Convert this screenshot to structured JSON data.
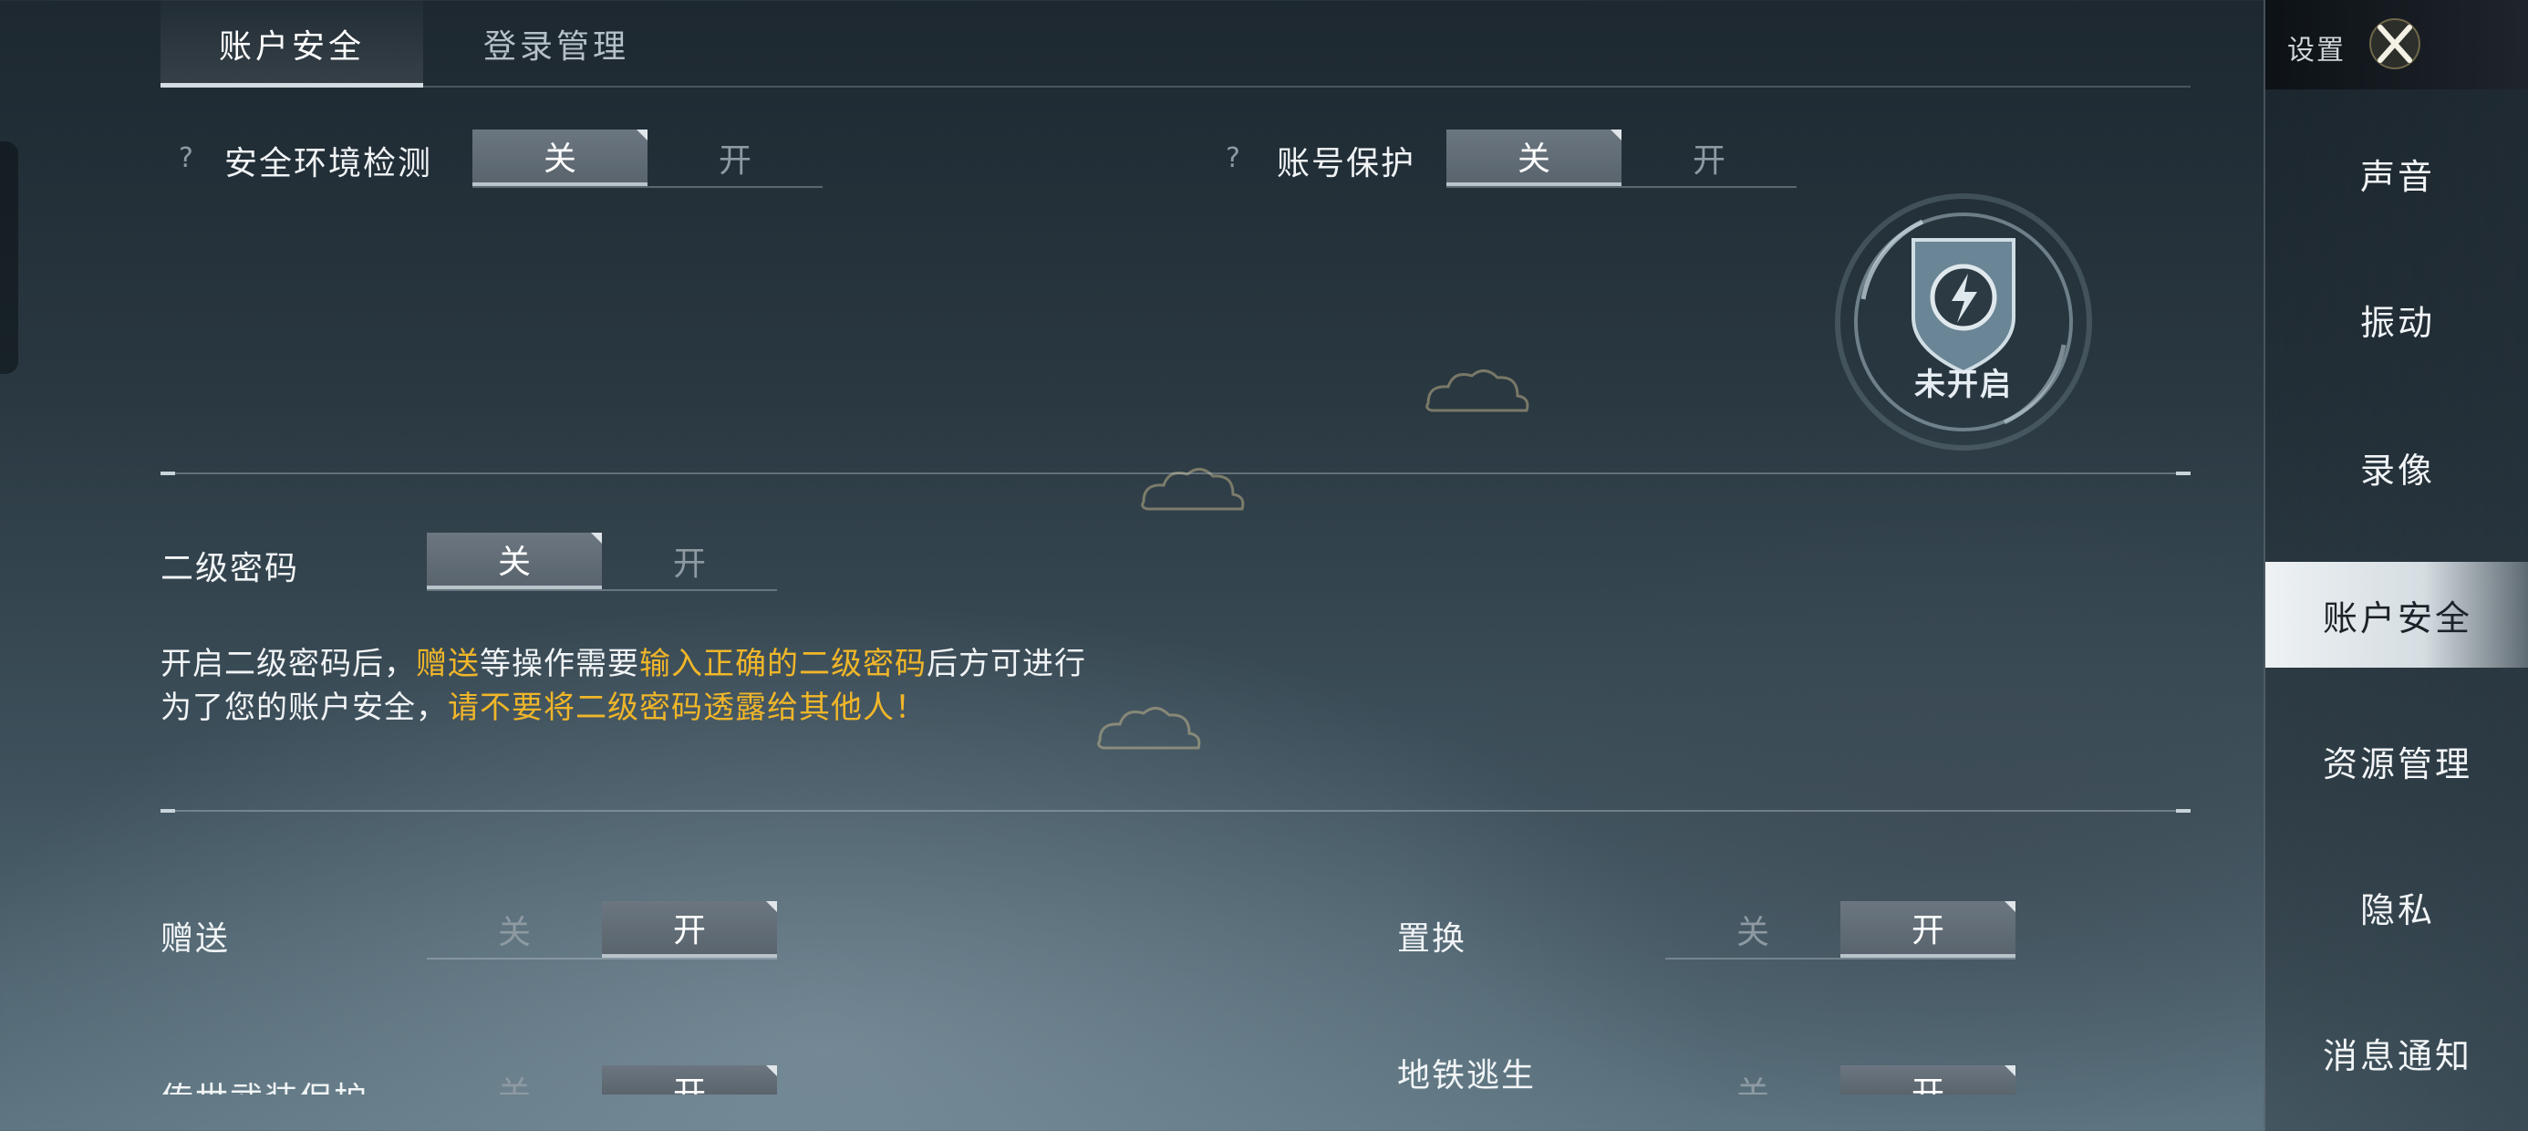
{
  "tabs": [
    {
      "label": "账户安全",
      "active": true
    },
    {
      "label": "登录管理",
      "active": false
    }
  ],
  "security_env": {
    "help": "?",
    "label": "安全环境检测",
    "off": "关",
    "on": "开",
    "state": "off"
  },
  "account_protect": {
    "help": "?",
    "label": "账号保护",
    "off": "关",
    "on": "开",
    "state": "off"
  },
  "badge": {
    "text": "未开启",
    "icon": "shield-lightning-icon"
  },
  "second_password": {
    "label": "二级密码",
    "off": "关",
    "on": "开",
    "state": "off"
  },
  "description": {
    "line1": {
      "a": "开启二级密码后，",
      "b": "赠送",
      "c": "等操作需要",
      "d": "输入正确的二级密码",
      "e": "后方可进行"
    },
    "line2": {
      "a": "为了您的账户安全，",
      "b": "请不要将二级密码透露给其他人！"
    }
  },
  "gift": {
    "label": "赠送",
    "off": "关",
    "on": "开",
    "state": "on"
  },
  "exchange": {
    "label": "置换",
    "off": "关",
    "on": "开",
    "state": "on"
  },
  "legend_armor": {
    "label": "传世武装保护",
    "off": "关",
    "on": "开",
    "state": "on"
  },
  "metro_escape": {
    "label": "地铁逃生",
    "off": "关",
    "on": "开",
    "state": "on"
  },
  "sidebar": {
    "title": "设置",
    "items": [
      {
        "label": "声音"
      },
      {
        "label": "振动"
      },
      {
        "label": "录像"
      },
      {
        "label": "账户安全",
        "active": true
      },
      {
        "label": "资源管理"
      },
      {
        "label": "隐私"
      },
      {
        "label": "消息通知"
      }
    ]
  },
  "colors": {
    "highlight": "#f0b629",
    "active_sidebar": "#e3e9ec"
  }
}
